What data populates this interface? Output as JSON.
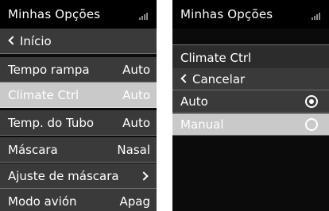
{
  "left_screen": {
    "title": "Minhas Opções",
    "rows": [
      {
        "label": "Início",
        "value": ""
      },
      {
        "label": "Tempo rampa",
        "value": "Auto"
      },
      {
        "label": "Climate Ctrl",
        "value": "Auto"
      },
      {
        "label": "Temp. do Tubo",
        "value": "Auto"
      },
      {
        "label": "Máscara",
        "value": "Nasal"
      },
      {
        "label": "Ajuste de máscara",
        "value": ""
      },
      {
        "label": "Modo avión",
        "value": "Apag"
      }
    ]
  },
  "right_screen": {
    "title": "Minhas Opções",
    "header": "Climate Ctrl",
    "cancel_label": "Cancelar",
    "options": [
      {
        "label": "Auto",
        "checked": true
      },
      {
        "label": "Manual",
        "checked": false
      }
    ]
  },
  "icons": {
    "signal": "signal-strength-icon",
    "back": "chevron-left-icon",
    "forward": "chevron-right-icon",
    "radio": "radio-button-icon"
  }
}
